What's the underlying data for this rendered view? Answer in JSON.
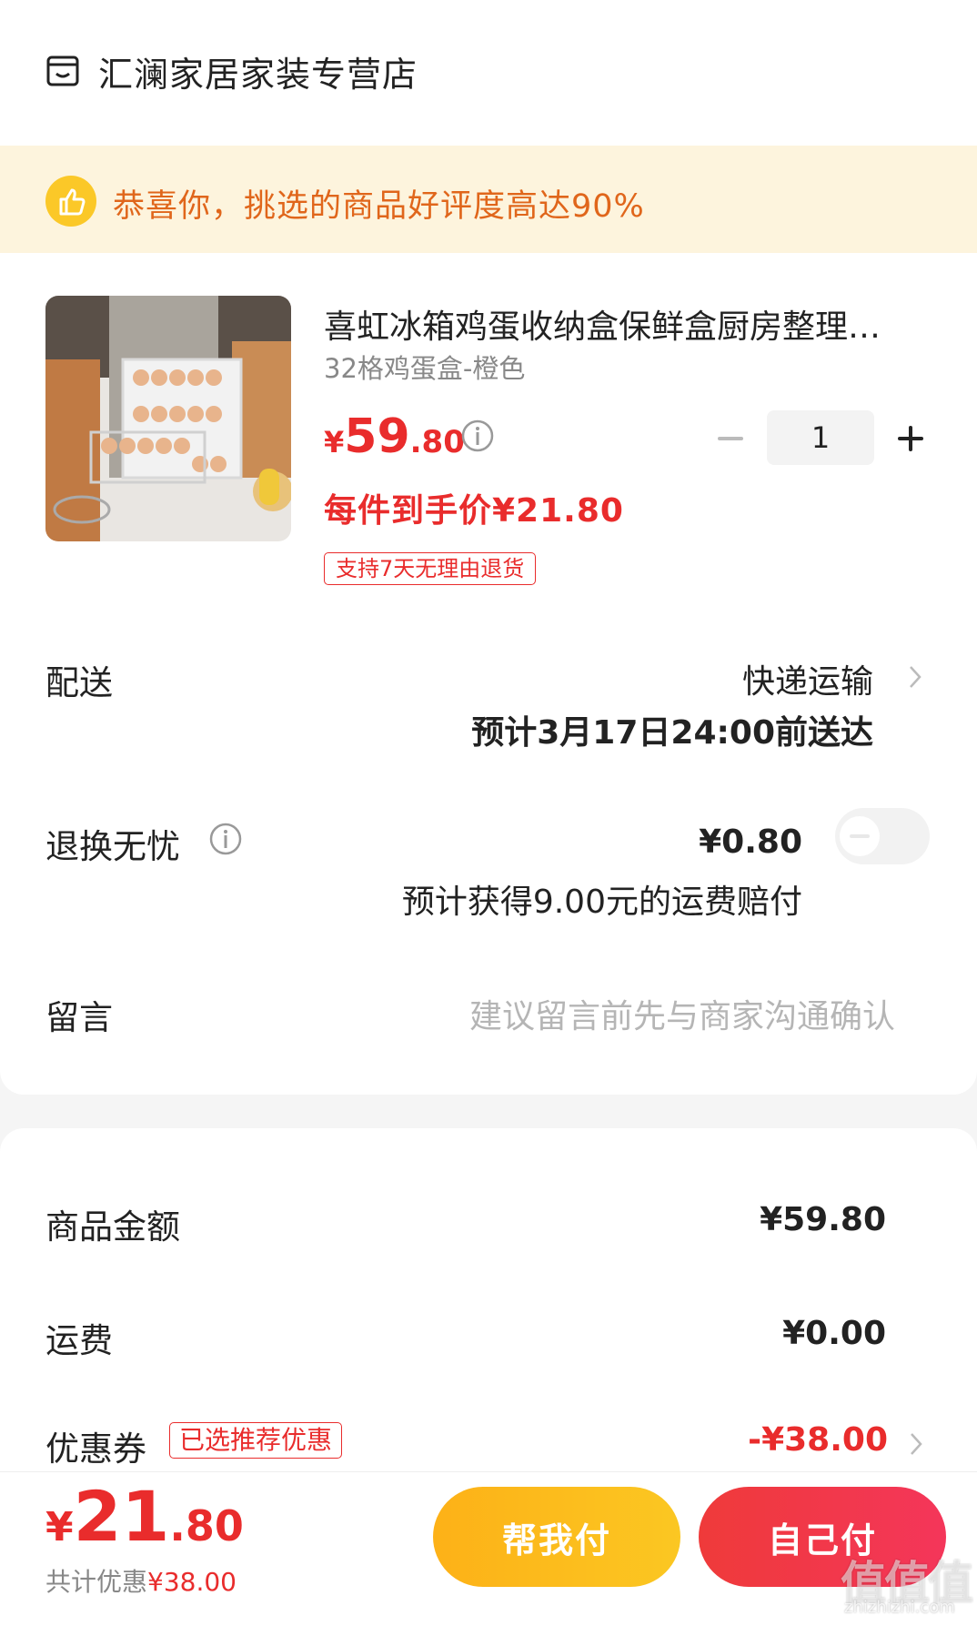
{
  "shop": {
    "name": "汇澜家居家装专营店",
    "icon": "shop-icon"
  },
  "banner": {
    "text": "恭喜你，挑选的商品好评度高达90%",
    "icon": "thumbs-up-icon",
    "color": "#e0661b",
    "background": "#fdf4dd"
  },
  "product": {
    "title": "喜虹冰箱鸡蛋收纳盒保鲜盒厨房整理…",
    "spec": "32格鸡蛋盒-橙色",
    "price": {
      "currency": "¥",
      "integer": "59",
      "decimal": ".80"
    },
    "per_item_price": "每件到手价¥21.80",
    "return_tag": "支持7天无理由退货",
    "quantity": "1"
  },
  "delivery": {
    "label": "配送",
    "method": "快递运输",
    "eta": "预计3月17日24:00前送达"
  },
  "worry_free": {
    "label": "退换无忧",
    "price": "¥0.80",
    "note": "预计获得9.00元的运费赔付",
    "enabled": false
  },
  "message": {
    "label": "留言",
    "placeholder": "建议留言前先与商家沟通确认"
  },
  "summary": {
    "amount_label": "商品金额",
    "amount_value": "¥59.80",
    "shipping_label": "运费",
    "shipping_value": "¥0.00",
    "coupon_label": "优惠券",
    "coupon_tag": "已选推荐优惠",
    "coupon_value": "-¥38.00"
  },
  "footer": {
    "total": {
      "currency": "¥",
      "integer": "21",
      "decimal": ".80"
    },
    "savings_prefix": "共计优惠",
    "savings_value": "¥38.00",
    "help_pay_label": "帮我付",
    "self_pay_label": "自己付"
  },
  "watermark": {
    "text": "值值值",
    "sub": "zhizhizhi.com"
  },
  "colors": {
    "accent_red": "#e92c2c",
    "accent_yellow": "#fbc828"
  }
}
